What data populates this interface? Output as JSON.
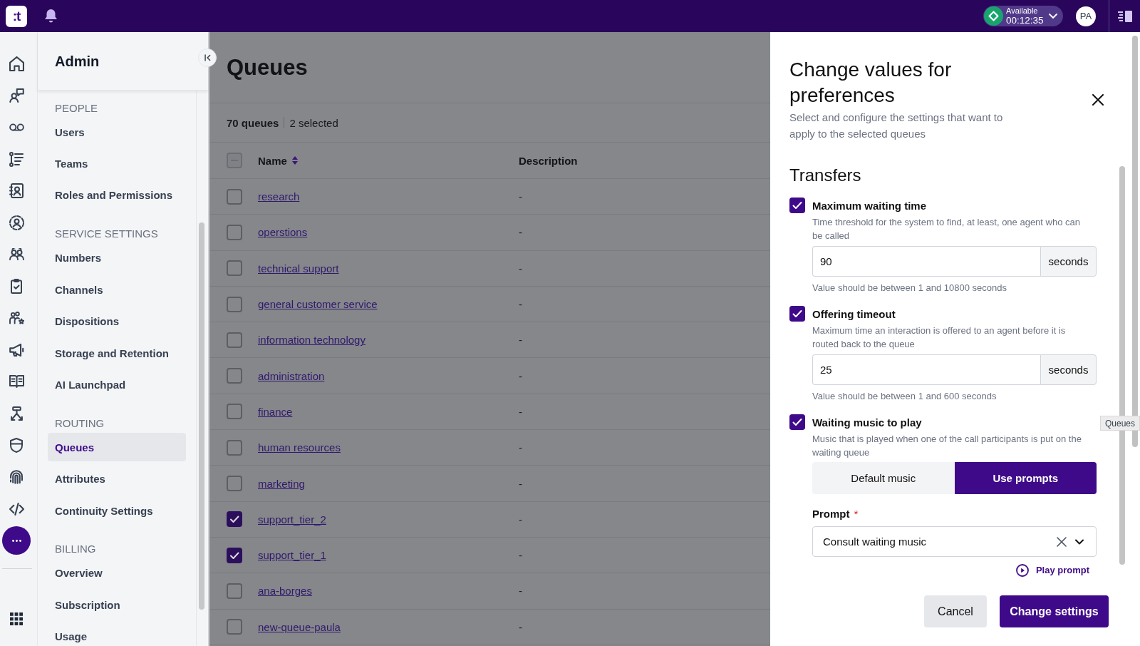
{
  "top_bar": {
    "logo": ":t",
    "status": {
      "label": "Available",
      "timer": "00:12:35"
    },
    "avatar": "PA"
  },
  "sidebar": {
    "title": "Admin",
    "sections": [
      {
        "heading": "PEOPLE",
        "items": [
          {
            "label": "Users",
            "selected": false
          },
          {
            "label": "Teams",
            "selected": false
          },
          {
            "label": "Roles and Permissions",
            "selected": false
          }
        ]
      },
      {
        "heading": "SERVICE SETTINGS",
        "items": [
          {
            "label": "Numbers",
            "selected": false
          },
          {
            "label": "Channels",
            "selected": false
          },
          {
            "label": "Dispositions",
            "selected": false
          },
          {
            "label": "Storage and Retention",
            "selected": false
          },
          {
            "label": "AI Launchpad",
            "selected": false
          }
        ]
      },
      {
        "heading": "ROUTING",
        "items": [
          {
            "label": "Queues",
            "selected": true
          },
          {
            "label": "Attributes",
            "selected": false
          },
          {
            "label": "Continuity Settings",
            "selected": false
          }
        ]
      },
      {
        "heading": "BILLING",
        "items": [
          {
            "label": "Overview",
            "selected": false
          },
          {
            "label": "Subscription",
            "selected": false
          },
          {
            "label": "Usage",
            "selected": false
          }
        ]
      }
    ]
  },
  "main": {
    "title": "Queues",
    "count": "70 queues",
    "selection": "2 selected",
    "table": {
      "header_checkbox": {
        "indeterminate": true
      },
      "columns": [
        {
          "label": "Name",
          "sortable": true
        },
        {
          "label": "Description",
          "sortable": false
        }
      ],
      "rows": [
        {
          "name": "research",
          "description": "-",
          "selected": false
        },
        {
          "name": "operstions",
          "description": "-",
          "selected": false
        },
        {
          "name": "technical support",
          "description": "-",
          "selected": false
        },
        {
          "name": "general customer service",
          "description": "-",
          "selected": false
        },
        {
          "name": "information technology",
          "description": "-",
          "selected": false
        },
        {
          "name": "administration",
          "description": "-",
          "selected": false
        },
        {
          "name": "finance",
          "description": "-",
          "selected": false
        },
        {
          "name": "human resources",
          "description": "-",
          "selected": false
        },
        {
          "name": "marketing",
          "description": "-",
          "selected": false
        },
        {
          "name": "support_tier_2",
          "description": "-",
          "selected": true
        },
        {
          "name": "support_tier_1",
          "description": "-",
          "selected": true
        },
        {
          "name": "ana-borges",
          "description": "-",
          "selected": false
        },
        {
          "name": "new-queue-paula",
          "description": "-",
          "selected": false
        }
      ]
    }
  },
  "panel": {
    "title": "Change values for preferences",
    "subtitle": "Select and configure the settings that want to apply to the selected queues",
    "section": "Transfers",
    "settings": [
      {
        "kind": "number",
        "label": "Maximum waiting time",
        "checked": true,
        "description": "Time threshold for the system to find, at least, one agent who can be called",
        "value": "90",
        "unit": "seconds",
        "hint": "Value should be between 1 and 10800 seconds"
      },
      {
        "kind": "number",
        "label": "Offering timeout",
        "checked": true,
        "description": "Maximum time an interaction is offered to an agent before it is routed back to the queue",
        "value": "25",
        "unit": "seconds",
        "hint": "Value should be between 1 and 600 seconds"
      },
      {
        "kind": "music",
        "label": "Waiting music to play",
        "checked": true,
        "description": "Music that is played when one of the call participants is put on the waiting queue",
        "options": [
          {
            "label": "Default music",
            "selected": false
          },
          {
            "label": "Use prompts",
            "selected": true
          }
        ],
        "field": {
          "label": "Prompt",
          "required_mark": "*",
          "value": "Consult waiting music"
        },
        "link": "Play prompt"
      }
    ],
    "buttons": [
      {
        "label": "Cancel",
        "kind": "secondary"
      },
      {
        "label": "Change settings",
        "kind": "primary"
      }
    ]
  },
  "tooltip": "Queues"
}
